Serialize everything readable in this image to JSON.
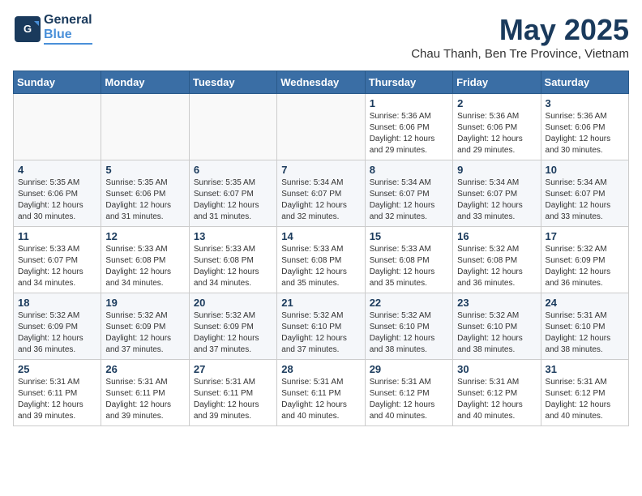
{
  "logo": {
    "line1": "General",
    "line2": "Blue"
  },
  "title": "May 2025",
  "subtitle": "Chau Thanh, Ben Tre Province, Vietnam",
  "headers": [
    "Sunday",
    "Monday",
    "Tuesday",
    "Wednesday",
    "Thursday",
    "Friday",
    "Saturday"
  ],
  "weeks": [
    [
      {
        "day": "",
        "info": ""
      },
      {
        "day": "",
        "info": ""
      },
      {
        "day": "",
        "info": ""
      },
      {
        "day": "",
        "info": ""
      },
      {
        "day": "1",
        "info": "Sunrise: 5:36 AM\nSunset: 6:06 PM\nDaylight: 12 hours\nand 29 minutes."
      },
      {
        "day": "2",
        "info": "Sunrise: 5:36 AM\nSunset: 6:06 PM\nDaylight: 12 hours\nand 29 minutes."
      },
      {
        "day": "3",
        "info": "Sunrise: 5:36 AM\nSunset: 6:06 PM\nDaylight: 12 hours\nand 30 minutes."
      }
    ],
    [
      {
        "day": "4",
        "info": "Sunrise: 5:35 AM\nSunset: 6:06 PM\nDaylight: 12 hours\nand 30 minutes."
      },
      {
        "day": "5",
        "info": "Sunrise: 5:35 AM\nSunset: 6:06 PM\nDaylight: 12 hours\nand 31 minutes."
      },
      {
        "day": "6",
        "info": "Sunrise: 5:35 AM\nSunset: 6:07 PM\nDaylight: 12 hours\nand 31 minutes."
      },
      {
        "day": "7",
        "info": "Sunrise: 5:34 AM\nSunset: 6:07 PM\nDaylight: 12 hours\nand 32 minutes."
      },
      {
        "day": "8",
        "info": "Sunrise: 5:34 AM\nSunset: 6:07 PM\nDaylight: 12 hours\nand 32 minutes."
      },
      {
        "day": "9",
        "info": "Sunrise: 5:34 AM\nSunset: 6:07 PM\nDaylight: 12 hours\nand 33 minutes."
      },
      {
        "day": "10",
        "info": "Sunrise: 5:34 AM\nSunset: 6:07 PM\nDaylight: 12 hours\nand 33 minutes."
      }
    ],
    [
      {
        "day": "11",
        "info": "Sunrise: 5:33 AM\nSunset: 6:07 PM\nDaylight: 12 hours\nand 34 minutes."
      },
      {
        "day": "12",
        "info": "Sunrise: 5:33 AM\nSunset: 6:08 PM\nDaylight: 12 hours\nand 34 minutes."
      },
      {
        "day": "13",
        "info": "Sunrise: 5:33 AM\nSunset: 6:08 PM\nDaylight: 12 hours\nand 34 minutes."
      },
      {
        "day": "14",
        "info": "Sunrise: 5:33 AM\nSunset: 6:08 PM\nDaylight: 12 hours\nand 35 minutes."
      },
      {
        "day": "15",
        "info": "Sunrise: 5:33 AM\nSunset: 6:08 PM\nDaylight: 12 hours\nand 35 minutes."
      },
      {
        "day": "16",
        "info": "Sunrise: 5:32 AM\nSunset: 6:08 PM\nDaylight: 12 hours\nand 36 minutes."
      },
      {
        "day": "17",
        "info": "Sunrise: 5:32 AM\nSunset: 6:09 PM\nDaylight: 12 hours\nand 36 minutes."
      }
    ],
    [
      {
        "day": "18",
        "info": "Sunrise: 5:32 AM\nSunset: 6:09 PM\nDaylight: 12 hours\nand 36 minutes."
      },
      {
        "day": "19",
        "info": "Sunrise: 5:32 AM\nSunset: 6:09 PM\nDaylight: 12 hours\nand 37 minutes."
      },
      {
        "day": "20",
        "info": "Sunrise: 5:32 AM\nSunset: 6:09 PM\nDaylight: 12 hours\nand 37 minutes."
      },
      {
        "day": "21",
        "info": "Sunrise: 5:32 AM\nSunset: 6:10 PM\nDaylight: 12 hours\nand 37 minutes."
      },
      {
        "day": "22",
        "info": "Sunrise: 5:32 AM\nSunset: 6:10 PM\nDaylight: 12 hours\nand 38 minutes."
      },
      {
        "day": "23",
        "info": "Sunrise: 5:32 AM\nSunset: 6:10 PM\nDaylight: 12 hours\nand 38 minutes."
      },
      {
        "day": "24",
        "info": "Sunrise: 5:31 AM\nSunset: 6:10 PM\nDaylight: 12 hours\nand 38 minutes."
      }
    ],
    [
      {
        "day": "25",
        "info": "Sunrise: 5:31 AM\nSunset: 6:11 PM\nDaylight: 12 hours\nand 39 minutes."
      },
      {
        "day": "26",
        "info": "Sunrise: 5:31 AM\nSunset: 6:11 PM\nDaylight: 12 hours\nand 39 minutes."
      },
      {
        "day": "27",
        "info": "Sunrise: 5:31 AM\nSunset: 6:11 PM\nDaylight: 12 hours\nand 39 minutes."
      },
      {
        "day": "28",
        "info": "Sunrise: 5:31 AM\nSunset: 6:11 PM\nDaylight: 12 hours\nand 40 minutes."
      },
      {
        "day": "29",
        "info": "Sunrise: 5:31 AM\nSunset: 6:12 PM\nDaylight: 12 hours\nand 40 minutes."
      },
      {
        "day": "30",
        "info": "Sunrise: 5:31 AM\nSunset: 6:12 PM\nDaylight: 12 hours\nand 40 minutes."
      },
      {
        "day": "31",
        "info": "Sunrise: 5:31 AM\nSunset: 6:12 PM\nDaylight: 12 hours\nand 40 minutes."
      }
    ]
  ]
}
